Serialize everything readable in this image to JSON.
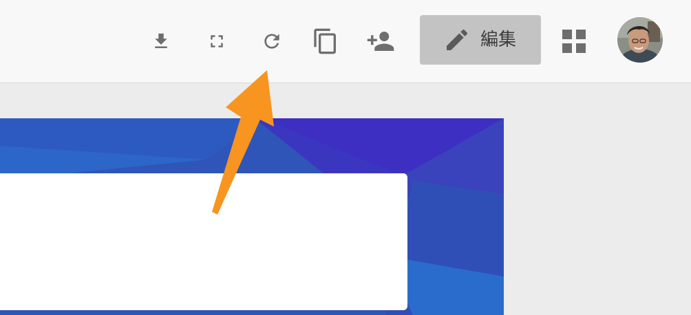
{
  "toolbar": {
    "icons": [
      {
        "name": "download-icon"
      },
      {
        "name": "fullscreen-icon"
      },
      {
        "name": "refresh-icon"
      },
      {
        "name": "copy-icon"
      },
      {
        "name": "add-person-icon"
      },
      {
        "name": "apps-grid-icon"
      }
    ],
    "edit_button": {
      "label": "編集",
      "icon": "pencil-icon"
    },
    "avatar": {
      "icon": "user-avatar"
    }
  },
  "colors": {
    "toolbar_bg": "#f8f8f8",
    "icon": "#6e6e6e",
    "edit_button_bg": "#c3c3c3",
    "canvas_bg": "#ececec",
    "slide_blue": "#2f55b8",
    "slide_indigo": "#3b31c0",
    "annotation_arrow": "#f79520"
  }
}
